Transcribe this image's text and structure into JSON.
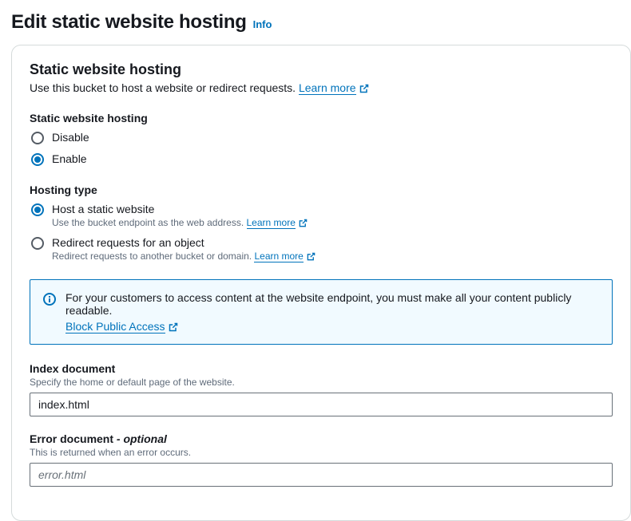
{
  "header": {
    "title": "Edit static website hosting",
    "info_label": "Info"
  },
  "panel": {
    "title": "Static website hosting",
    "desc_text": "Use this bucket to host a website or redirect requests. ",
    "learn_more": "Learn more"
  },
  "swh_group": {
    "label": "Static website hosting",
    "disable": "Disable",
    "enable": "Enable"
  },
  "hosting_type": {
    "label": "Hosting type",
    "host_static": "Host a static website",
    "host_static_sub": "Use the bucket endpoint as the web address. ",
    "redirect": "Redirect requests for an object",
    "redirect_sub": "Redirect requests to another bucket or domain. ",
    "learn_more": "Learn more"
  },
  "alert": {
    "text": "For your customers to access content at the website endpoint, you must make all your content publicly readable.",
    "link": "Block Public Access"
  },
  "index_doc": {
    "label": "Index document",
    "sub": "Specify the home or default page of the website.",
    "value": "index.html"
  },
  "error_doc": {
    "label_main": "Error document",
    "label_opt": " - optional",
    "sub": "This is returned when an error occurs.",
    "placeholder": "error.html"
  }
}
